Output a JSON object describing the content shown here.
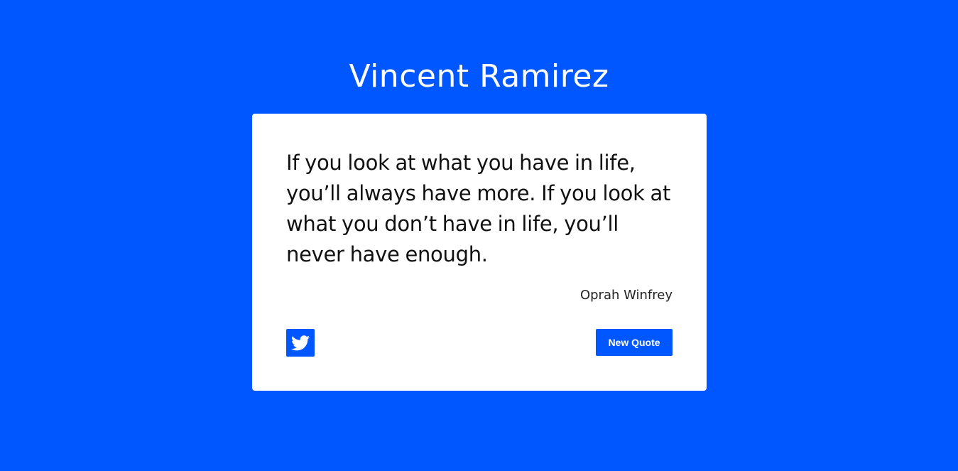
{
  "header": {
    "title": "Vincent Ramirez"
  },
  "quote": {
    "text": "If you look at what you have in life, you’ll always have more. If you look at what you don’t have in life, you’ll never have enough.",
    "author": "Oprah Winfrey"
  },
  "actions": {
    "tweet_icon": "twitter-icon",
    "new_quote_label": "New Quote"
  },
  "colors": {
    "background": "#0057ff",
    "card": "#ffffff",
    "accent": "#0057ff"
  }
}
